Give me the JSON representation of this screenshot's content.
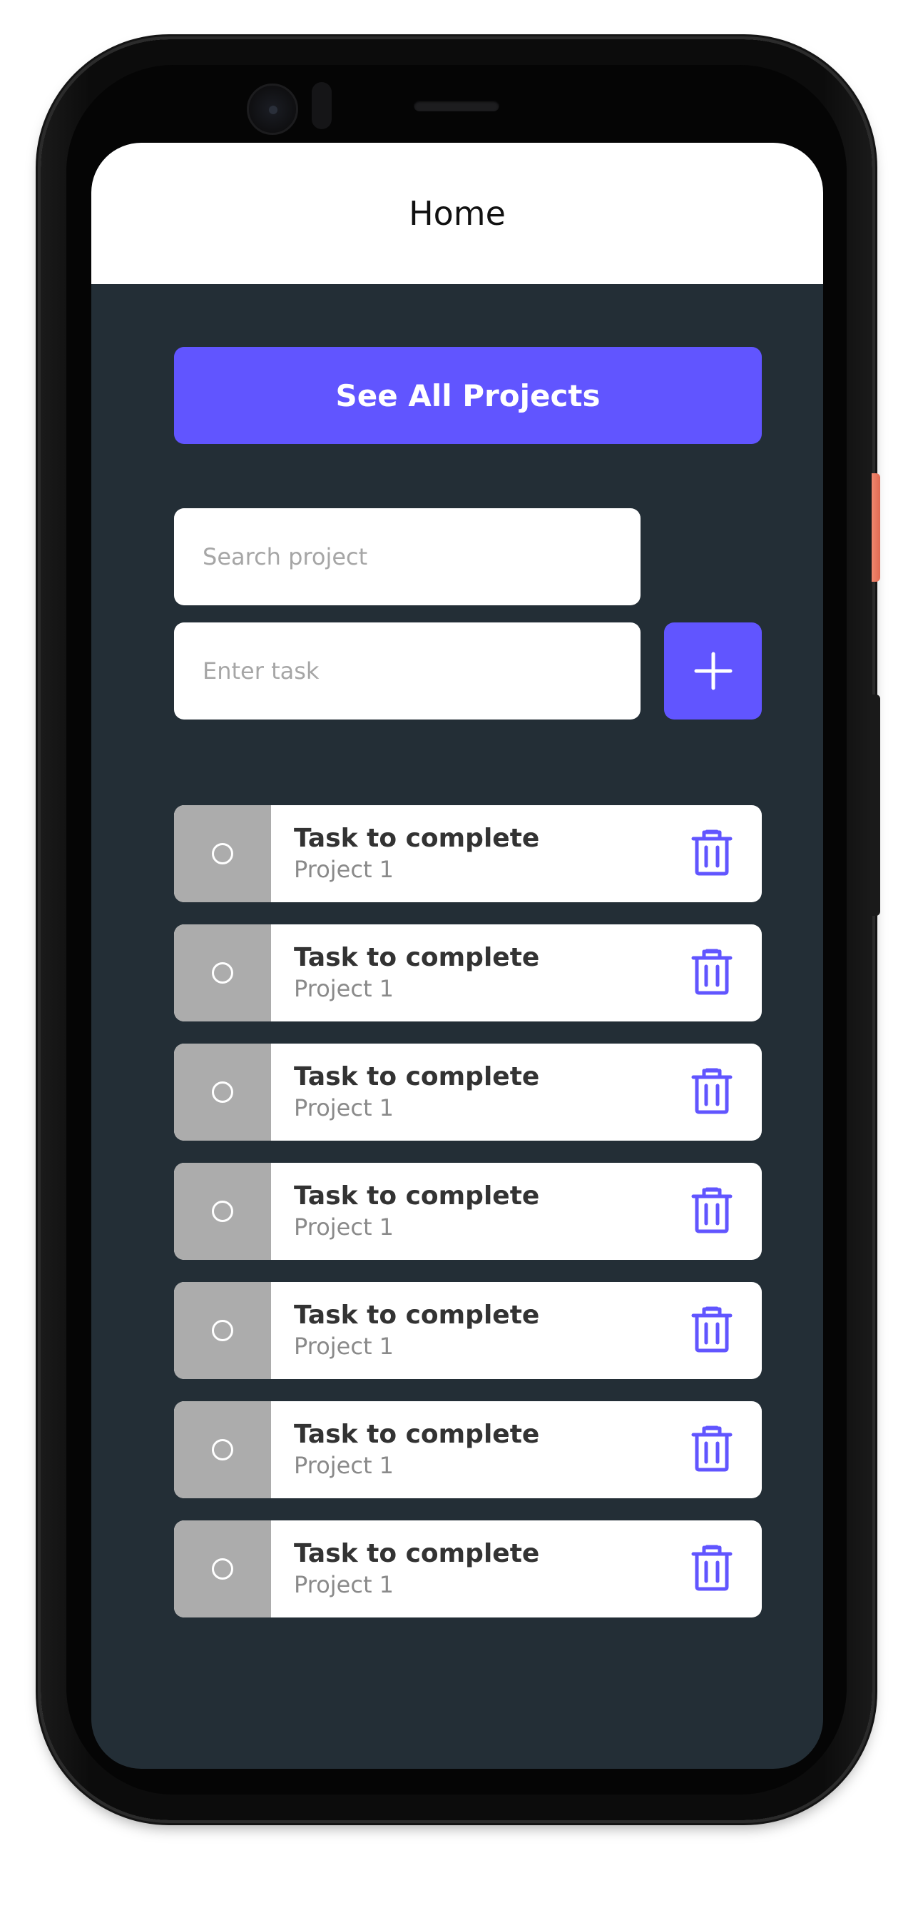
{
  "header": {
    "title": "Home"
  },
  "actions": {
    "see_all_label": "See All Projects"
  },
  "search": {
    "placeholder": "Search project",
    "value": ""
  },
  "task_input": {
    "placeholder": "Enter task",
    "value": ""
  },
  "tasks": [
    {
      "title": "Task to complete",
      "project": "Project 1"
    },
    {
      "title": "Task to complete",
      "project": "Project 1"
    },
    {
      "title": "Task to complete",
      "project": "Project 1"
    },
    {
      "title": "Task to complete",
      "project": "Project 1"
    },
    {
      "title": "Task to complete",
      "project": "Project 1"
    },
    {
      "title": "Task to complete",
      "project": "Project 1"
    },
    {
      "title": "Task to complete",
      "project": "Project 1"
    }
  ],
  "icons": {
    "add": "plus-icon",
    "delete": "trash-icon",
    "check": "circle-icon"
  },
  "colors": {
    "accent": "#6155ff",
    "background": "#232e36",
    "check_area": "#acacac"
  }
}
